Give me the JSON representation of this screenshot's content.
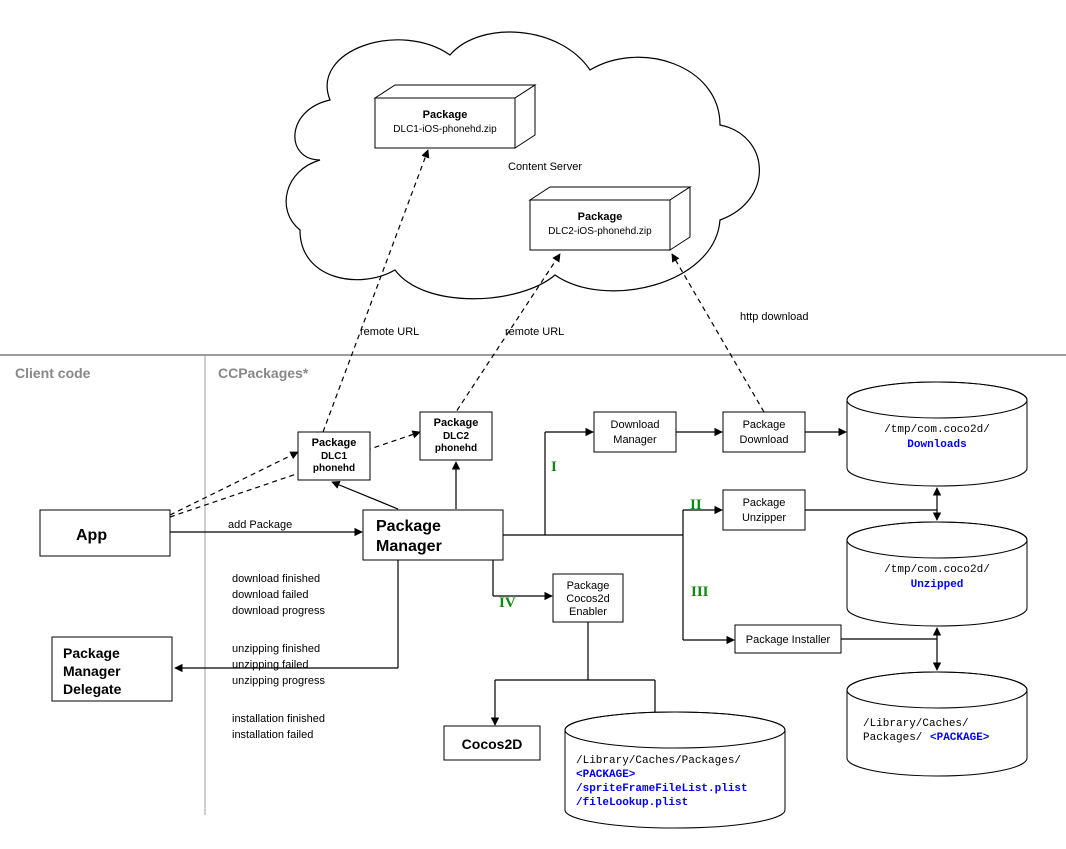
{
  "sections": {
    "client_code": "Client code",
    "ccpackages": "CCPackages*"
  },
  "cloud": {
    "label": "Content Server",
    "pkg1": {
      "title": "Package",
      "file": "DLC1-iOS-phonehd.zip"
    },
    "pkg2": {
      "title": "Package",
      "file": "DLC2-iOS-phonehd.zip"
    }
  },
  "edges": {
    "remote_url_1": "remote URL",
    "remote_url_2": "remote URL",
    "http_download": "http download",
    "add_package": "add Package"
  },
  "steps": {
    "i": "I",
    "ii": "II",
    "iii": "III",
    "iv": "IV"
  },
  "nodes": {
    "app": "App",
    "delegate_l1": "Package",
    "delegate_l2": "Manager",
    "delegate_l3": "Delegate",
    "pkg_local_title": "Package",
    "pkg_local_1a": "DLC1",
    "pkg_local_1b": "phonehd",
    "pkg_local_2a": "DLC2",
    "pkg_local_2b": "phonehd",
    "pkg_mgr_l1": "Package",
    "pkg_mgr_l2": "Manager",
    "download_mgr_l1": "Download",
    "download_mgr_l2": "Manager",
    "pkg_download_l1": "Package",
    "pkg_download_l2": "Download",
    "pkg_unzipper_l1": "Package",
    "pkg_unzipper_l2": "Unzipper",
    "pkg_installer": "Package Installer",
    "enabler_l1": "Package",
    "enabler_l2": "Cocos2d",
    "enabler_l3": "Enabler",
    "cocos2d": "Cocos2D"
  },
  "events": {
    "l1": "download finished",
    "l2": "download failed",
    "l3": "download progress",
    "l4": "unzipping finished",
    "l5": "unzipping failed",
    "l6": "unzipping progress",
    "l7": "installation finished",
    "l8": "installation failed"
  },
  "storage": {
    "downloads_path": "/tmp/com.coco2d/",
    "downloads_leaf": "Downloads",
    "unzipped_path": "/tmp/com.coco2d/",
    "unzipped_leaf": "Unzipped",
    "library_path_l1": "/Library/Caches/",
    "library_path_l2": "Packages/",
    "library_leaf": "<PACKAGE>",
    "enabler_path": "/Library/Caches/Packages/",
    "enabler_leaf": "<PACKAGE>",
    "enabler_f1": "  /spriteFrameFileList.plist",
    "enabler_f2": "  /fileLookup.plist"
  }
}
